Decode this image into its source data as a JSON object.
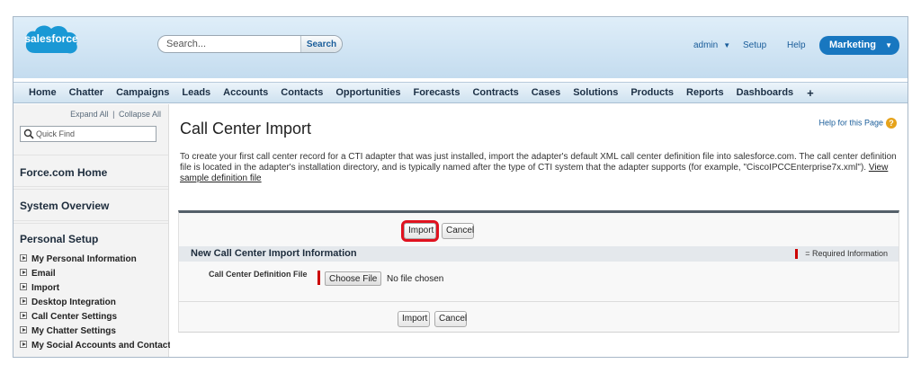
{
  "header": {
    "logo_text": "salesforce",
    "search": {
      "placeholder": "Search...",
      "button_label": "Search"
    },
    "user_menu_label": "admin",
    "setup_label": "Setup",
    "help_label": "Help",
    "app_menu_label": "Marketing"
  },
  "tabs": [
    "Home",
    "Chatter",
    "Campaigns",
    "Leads",
    "Accounts",
    "Contacts",
    "Opportunities",
    "Forecasts",
    "Contracts",
    "Cases",
    "Solutions",
    "Products",
    "Reports",
    "Dashboards"
  ],
  "tab_plus": "+",
  "sidebar": {
    "expand_all": "Expand All",
    "separator": "|",
    "collapse_all": "Collapse All",
    "quick_find_placeholder": "Quick Find",
    "sections": {
      "forcecom_home": "Force.com Home",
      "system_overview": "System Overview",
      "personal_setup": "Personal Setup"
    },
    "personal_items": [
      "My Personal Information",
      "Email",
      "Import",
      "Desktop Integration",
      "Call Center Settings",
      "My Chatter Settings",
      "My Social Accounts and Contacts"
    ]
  },
  "main": {
    "title": "Call Center Import",
    "help_link": "Help for this Page",
    "help_badge": "?",
    "description": "To create your first call center record for a CTI adapter that was just installed, import the adapter's default XML call center definition file into salesforce.com. The call center definition file is located in the adapter's installation directory, and is typically named after the type of CTI system that the adapter supports (for example, \"CiscoIPCCEnterprise7x.xml\").",
    "sample_link": "View sample definition file",
    "import_label": "Import",
    "cancel_label": "Cancel",
    "section_title": "New Call Center Import Information",
    "required_info": "= Required Information",
    "field_label": "Call Center Definition File",
    "choose_file_label": "Choose File",
    "no_file_text": "No file chosen"
  },
  "colors": {
    "app_menu_bg": "#1877c0",
    "highlight_outline": "#e0121f",
    "required_marker": "#cc0000",
    "panel_top_border": "#545f69"
  }
}
